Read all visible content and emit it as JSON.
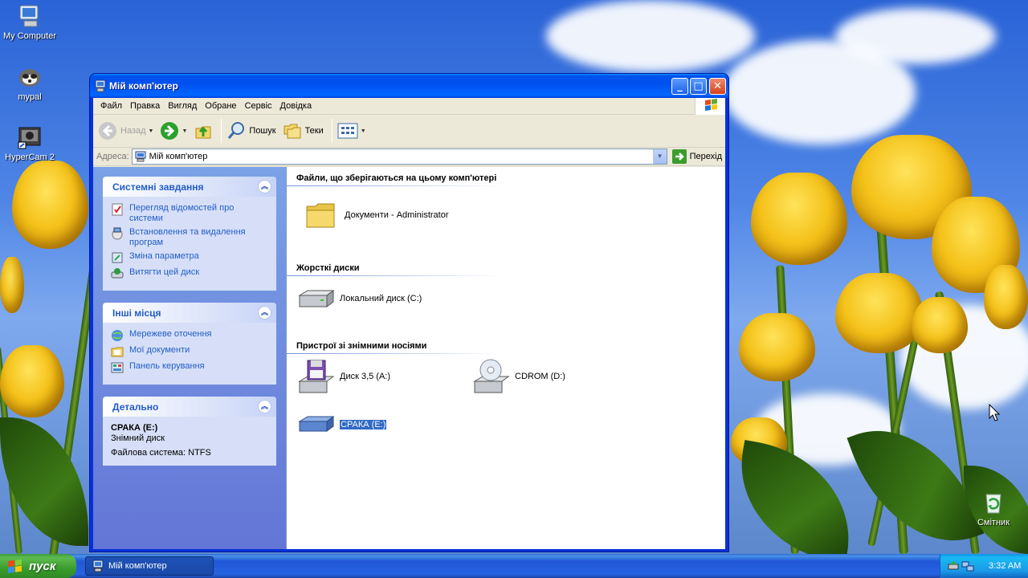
{
  "desktop": {
    "icons": [
      {
        "label": "My Computer",
        "icon": "my-computer-icon"
      },
      {
        "label": "mypal",
        "icon": "mypal-icon"
      },
      {
        "label": "HyperCam 2",
        "icon": "hypercam-icon"
      },
      {
        "label": "Смітник",
        "icon": "recycle-bin-icon"
      }
    ]
  },
  "window": {
    "title": "Мій комп'ютер",
    "buttons": {
      "minimize": "_",
      "maximize": "□",
      "close": "✕"
    }
  },
  "menu": [
    "Файл",
    "Правка",
    "Вигляд",
    "Обране",
    "Сервіс",
    "Довідка"
  ],
  "toolbar": {
    "back_label": "Назад",
    "search_label": "Пошук",
    "folders_label": "Теки"
  },
  "address": {
    "label": "Адреса:",
    "value": "Мій комп'ютер",
    "go_label": "Перехід"
  },
  "panels": {
    "system_tasks": {
      "title": "Системні завдання",
      "items": [
        "Перегляд відомостей про системи",
        "Встановлення та видалення програм",
        "Зміна параметра",
        "Витягти цей диск"
      ]
    },
    "other_places": {
      "title": "Інші місця",
      "items": [
        "Мережеве оточення",
        "Мої документи",
        "Панель керування"
      ]
    },
    "details": {
      "title": "Детально",
      "name": "СРАКА (E:)",
      "type": "Знімний диск",
      "fs": "Файлова система: NTFS"
    }
  },
  "groups": {
    "stored": {
      "title": "Файли, що зберігаються на цьому комп'ютері",
      "items": [
        "Документи - Administrator"
      ]
    },
    "hdd": {
      "title": "Жорсткі диски",
      "items": [
        "Локальний диск (C:)"
      ]
    },
    "removable": {
      "title": "Пристрої зі знімними носіями",
      "items": [
        "Диск 3,5 (A:)",
        "CDROM (D:)",
        "СРАКА (E:)"
      ]
    }
  },
  "taskbar": {
    "start_label": "пуск",
    "task_label": "Мій комп'ютер",
    "clock": "3:32 AM"
  },
  "colors": {
    "title_blue": "#0053ee",
    "link_blue": "#215dc6",
    "selection": "#316ac5",
    "start_green": "#3a9d2d"
  }
}
